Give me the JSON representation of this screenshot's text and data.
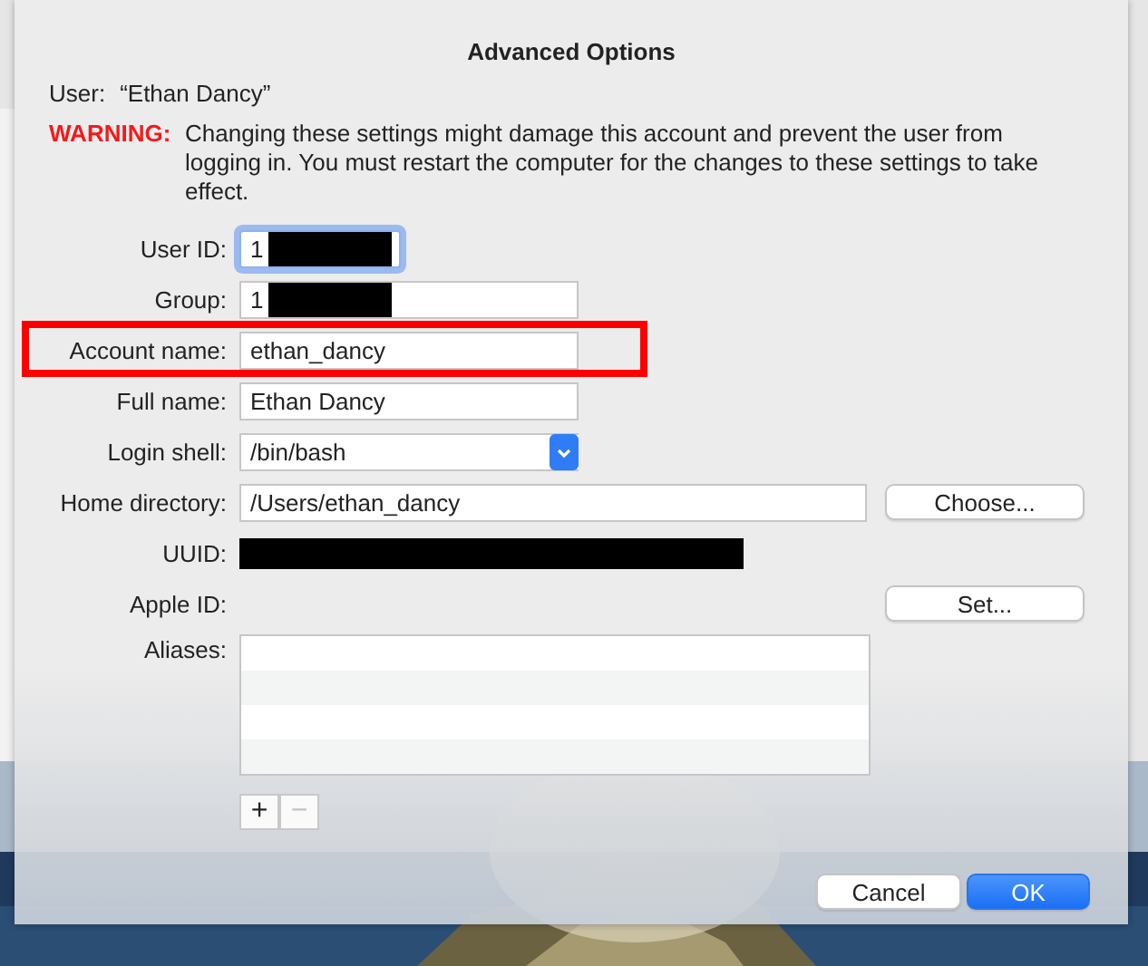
{
  "dialog": {
    "title": "Advanced Options",
    "user_label": "User:",
    "user_name": "“Ethan Dancy”",
    "warning_label": "WARNING:",
    "warning_text": "Changing these settings might damage this account and prevent the user from logging in. You must restart the computer for the changes to these settings to take effect.",
    "fields": [
      {
        "label": "User ID:",
        "kind": "text",
        "value": "1",
        "redacted": true,
        "focused": true,
        "annotated": false
      },
      {
        "label": "Group:",
        "kind": "text",
        "value": "1",
        "redacted": true,
        "focused": false,
        "annotated": false
      },
      {
        "label": "Account name:",
        "kind": "text",
        "value": "ethan_dancy",
        "redacted": false,
        "focused": false,
        "annotated": true
      },
      {
        "label": "Full name:",
        "kind": "text",
        "value": "Ethan Dancy",
        "redacted": false,
        "focused": false,
        "annotated": false
      },
      {
        "label": "Login shell:",
        "kind": "popup",
        "value": "/bin/bash",
        "annotated": false
      },
      {
        "label": "Home directory:",
        "kind": "text",
        "value": "/Users/ethan_dancy",
        "redacted": false,
        "focused": false,
        "annotated": false,
        "button": "Choose..."
      },
      {
        "label": "UUID:",
        "kind": "redacted",
        "annotated": false
      },
      {
        "label": "Apple ID:",
        "kind": "none",
        "annotated": false,
        "button": "Set..."
      },
      {
        "label": "Aliases:",
        "kind": "list",
        "annotated": false
      }
    ],
    "list_buttons": [
      {
        "label": "+",
        "disabled": false
      },
      {
        "label": "−",
        "disabled": true
      }
    ],
    "buttons": [
      {
        "label": "Cancel",
        "default": false
      },
      {
        "label": "OK",
        "default": true
      }
    ]
  }
}
